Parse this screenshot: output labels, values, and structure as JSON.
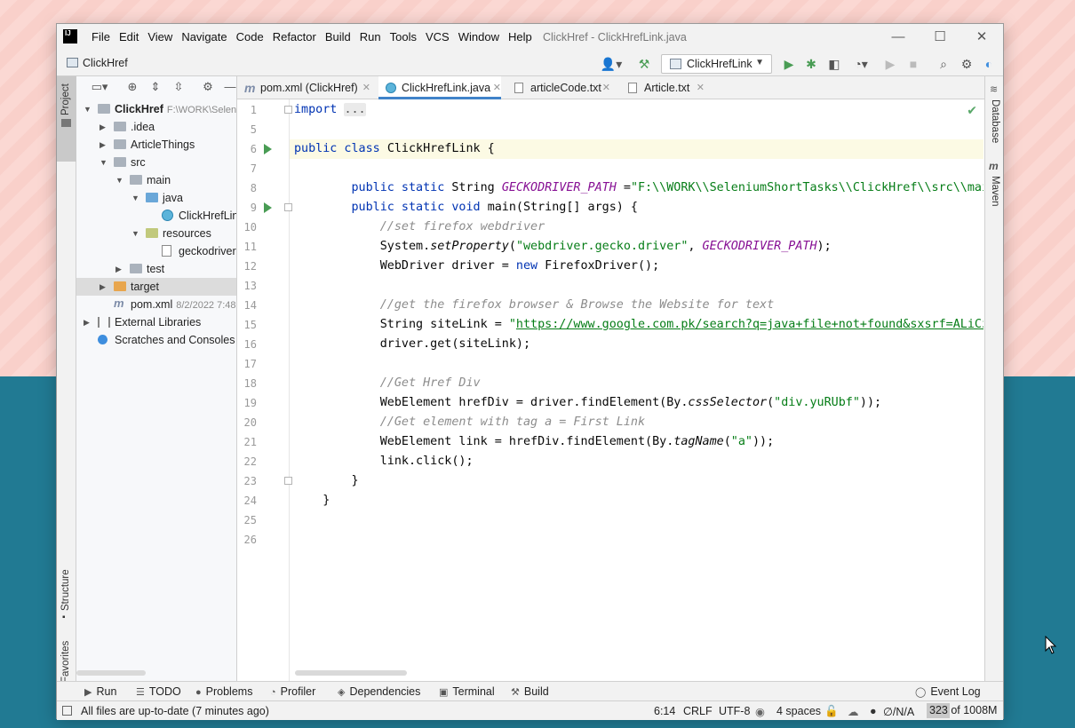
{
  "window": {
    "title": "ClickHref - ClickHrefLink.java",
    "app_logo": "IJ",
    "menu": [
      "File",
      "Edit",
      "View",
      "Navigate",
      "Code",
      "Refactor",
      "Build",
      "Run",
      "Tools",
      "VCS",
      "Window",
      "Help"
    ],
    "controls": {
      "minimize": "—",
      "maximize": "☐",
      "close": "✕"
    }
  },
  "navbar": {
    "project_name": "ClickHref",
    "run_config": "ClickHrefLink",
    "toolbar_icons": [
      "user-icon",
      "hammer-icon",
      "run-icon",
      "debug-icon",
      "coverage-icon",
      "profile-icon",
      "resume-icon",
      "stop-icon",
      "search-icon",
      "settings-icon",
      "update-icon"
    ]
  },
  "left_strip": {
    "project": "Project",
    "structure": "Structure",
    "favorites": "Favorites"
  },
  "right_strip": {
    "database": "Database",
    "maven": "Maven"
  },
  "project_tree": [
    {
      "label": "ClickHref",
      "meta": "F:\\WORK\\Selen",
      "bold": true,
      "depth": 0,
      "arrow": "▼",
      "icon": "folder-icon"
    },
    {
      "label": ".idea",
      "meta": "",
      "depth": 1,
      "arrow": "▶",
      "icon": "folder-icon"
    },
    {
      "label": "ArticleThings",
      "meta": "",
      "depth": 1,
      "arrow": "▶",
      "icon": "folder-icon"
    },
    {
      "label": "src",
      "meta": "",
      "depth": 1,
      "arrow": "▼",
      "icon": "folder-icon"
    },
    {
      "label": "main",
      "meta": "",
      "depth": 2,
      "arrow": "▼",
      "icon": "folder-icon"
    },
    {
      "label": "java",
      "meta": "",
      "depth": 3,
      "arrow": "▼",
      "icon": "source-folder-icon"
    },
    {
      "label": "ClickHrefLin",
      "meta": "",
      "depth": 4,
      "arrow": "",
      "icon": "java-class-icon"
    },
    {
      "label": "resources",
      "meta": "",
      "depth": 3,
      "arrow": "▼",
      "icon": "resources-folder-icon"
    },
    {
      "label": "geckodriver.",
      "meta": "",
      "depth": 4,
      "arrow": "",
      "icon": "file-icon"
    },
    {
      "label": "test",
      "meta": "",
      "depth": 2,
      "arrow": "▶",
      "icon": "folder-icon"
    },
    {
      "label": "target",
      "meta": "",
      "depth": 1,
      "arrow": "▶",
      "icon": "excluded-folder-icon",
      "selected": true
    },
    {
      "label": "pom.xml",
      "meta": "8/2/2022 7:48",
      "depth": 1,
      "arrow": "",
      "icon": "maven-icon"
    },
    {
      "label": "External Libraries",
      "meta": "",
      "depth": 0,
      "arrow": "▶",
      "icon": "libraries-icon"
    },
    {
      "label": "Scratches and Consoles",
      "meta": "",
      "depth": 0,
      "arrow": "",
      "icon": "scratches-icon"
    }
  ],
  "tabs": [
    {
      "label": "pom.xml (ClickHref)",
      "icon": "maven-icon",
      "active": false
    },
    {
      "label": "ClickHrefLink.java",
      "icon": "java-class-icon",
      "active": true
    },
    {
      "label": "articleCode.txt",
      "icon": "text-file-icon",
      "active": false
    },
    {
      "label": "Article.txt",
      "icon": "text-file-icon",
      "active": false
    }
  ],
  "editor": {
    "line_numbers": [
      "1",
      "5",
      "6",
      "7",
      "8",
      "9",
      "10",
      "11",
      "12",
      "13",
      "14",
      "15",
      "16",
      "17",
      "18",
      "19",
      "20",
      "21",
      "22",
      "23",
      "24",
      "25",
      "26"
    ],
    "code_lines": [
      [
        {
          "c": "kw",
          "t": "import "
        },
        {
          "c": "fold-dots",
          "t": "..."
        }
      ],
      [],
      [
        {
          "c": "kw",
          "t": "public class "
        },
        {
          "c": "",
          "t": "ClickHrefLink {"
        }
      ],
      [],
      [
        {
          "c": "",
          "t": "        "
        },
        {
          "c": "kw",
          "t": "public static "
        },
        {
          "c": "",
          "t": "String "
        },
        {
          "c": "sfield",
          "t": "GECKODRIVER_PATH"
        },
        {
          "c": "",
          "t": " ="
        },
        {
          "c": "str",
          "t": "\"F:\\\\WORK\\\\SeleniumShortTasks\\\\ClickHref\\\\src\\\\mai"
        }
      ],
      [
        {
          "c": "",
          "t": "        "
        },
        {
          "c": "kw",
          "t": "public static void "
        },
        {
          "c": "",
          "t": "main(String[] args) {"
        }
      ],
      [
        {
          "c": "",
          "t": "            "
        },
        {
          "c": "cmt",
          "t": "//set firefox webdriver"
        }
      ],
      [
        {
          "c": "",
          "t": "            System."
        },
        {
          "c": "smeth",
          "t": "setProperty"
        },
        {
          "c": "",
          "t": "("
        },
        {
          "c": "str",
          "t": "\"webdriver.gecko.driver\""
        },
        {
          "c": "",
          "t": ", "
        },
        {
          "c": "sfield",
          "t": "GECKODRIVER_PATH"
        },
        {
          "c": "",
          "t": ");"
        }
      ],
      [
        {
          "c": "",
          "t": "            WebDriver driver = "
        },
        {
          "c": "kw",
          "t": "new "
        },
        {
          "c": "",
          "t": "FirefoxDriver();"
        }
      ],
      [],
      [
        {
          "c": "",
          "t": "            "
        },
        {
          "c": "cmt",
          "t": "//get the firefox browser & Browse the Website for text"
        }
      ],
      [
        {
          "c": "",
          "t": "            String siteLink = "
        },
        {
          "c": "str",
          "t": "\""
        },
        {
          "c": "url",
          "t": "https://www.google.com.pk/search?q=java+file+not+found&sxsrf=ALiCz"
        }
      ],
      [
        {
          "c": "",
          "t": "            driver.get(siteLink);"
        }
      ],
      [],
      [
        {
          "c": "",
          "t": "            "
        },
        {
          "c": "cmt",
          "t": "//Get Href Div"
        }
      ],
      [
        {
          "c": "",
          "t": "            WebElement hrefDiv = driver.findElement(By."
        },
        {
          "c": "smeth",
          "t": "cssSelector"
        },
        {
          "c": "",
          "t": "("
        },
        {
          "c": "str",
          "t": "\"div.yuRUbf\""
        },
        {
          "c": "",
          "t": "));"
        }
      ],
      [
        {
          "c": "",
          "t": "            "
        },
        {
          "c": "cmt",
          "t": "//Get element with tag a = First Link"
        }
      ],
      [
        {
          "c": "",
          "t": "            WebElement link = hrefDiv.findElement(By."
        },
        {
          "c": "smeth",
          "t": "tagName"
        },
        {
          "c": "",
          "t": "("
        },
        {
          "c": "str",
          "t": "\"a\""
        },
        {
          "c": "",
          "t": "));"
        }
      ],
      [
        {
          "c": "",
          "t": "            link.click();"
        }
      ],
      [
        {
          "c": "",
          "t": "        }"
        }
      ],
      [
        {
          "c": "",
          "t": "    }"
        }
      ],
      [],
      []
    ]
  },
  "tool_windows": [
    {
      "label": "Run",
      "icon": "run-icon",
      "glyph": "▶"
    },
    {
      "label": "TODO",
      "icon": "todo-icon",
      "glyph": "☰"
    },
    {
      "label": "Problems",
      "icon": "problems-icon",
      "glyph": "●"
    },
    {
      "label": "Profiler",
      "icon": "profiler-icon",
      "glyph": "◔"
    },
    {
      "label": "Dependencies",
      "icon": "dependencies-icon",
      "glyph": "◈"
    },
    {
      "label": "Terminal",
      "icon": "terminal-icon",
      "glyph": "▣"
    },
    {
      "label": "Build",
      "icon": "build-icon",
      "glyph": "⚒"
    }
  ],
  "event_log": "Event Log",
  "status": {
    "message": "All files are up-to-date (7 minutes ago)",
    "caret_pos": "6:14",
    "line_sep": "CRLF",
    "encoding": "UTF-8",
    "indent": "4 spaces",
    "vcs": "∅/N/A",
    "memory": "323 of 1008M",
    "memory_fraction": 0.32
  },
  "colors": {
    "accent": "#4083c9",
    "run_green": "#499c54",
    "keyword": "#0033b3",
    "string": "#067d17",
    "desktop_bottom": "#217a93"
  }
}
